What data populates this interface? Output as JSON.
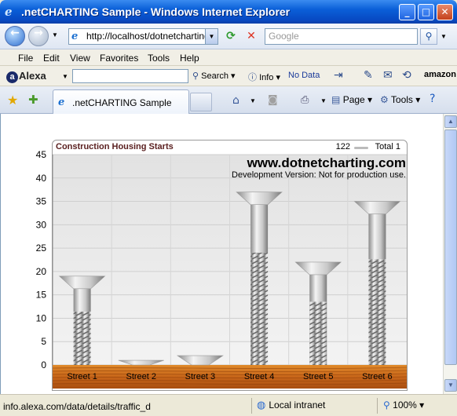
{
  "window": {
    "title": ".netCHARTING Sample - Windows Internet Explorer"
  },
  "nav": {
    "address": "http://localhost/dotnetcharting",
    "search_placeholder": "Google"
  },
  "menu": {
    "items": [
      "File",
      "Edit",
      "View",
      "Favorites",
      "Tools",
      "Help"
    ]
  },
  "alexa": {
    "logo": "Alexa",
    "search_label": "Search",
    "info_label": "Info",
    "no_data": "No Data",
    "amazon_label": "amazon"
  },
  "tabs": {
    "active_label": ".netCHARTING Sample",
    "page_label": "Page",
    "tools_label": "Tools"
  },
  "status": {
    "text": "info.alexa.com/data/details/traffic_d",
    "zone": "Local intranet",
    "zoom": "100%"
  },
  "chart_data": {
    "type": "bar",
    "title": "Construction Housing Starts",
    "legend": {
      "value": "122",
      "name": "Total 1"
    },
    "watermark": "www.dotnetcharting.com",
    "note": "Development Version: Not for production use.",
    "categories": [
      "Street 1",
      "Street 2",
      "Street 3",
      "Street 4",
      "Street 5",
      "Street 6"
    ],
    "values": [
      19,
      1,
      2,
      37,
      22,
      35
    ],
    "ylim": [
      0,
      45
    ],
    "yticks": [
      "0",
      "5",
      "10",
      "15",
      "20",
      "25",
      "30",
      "35",
      "40",
      "45"
    ],
    "grid": true
  }
}
